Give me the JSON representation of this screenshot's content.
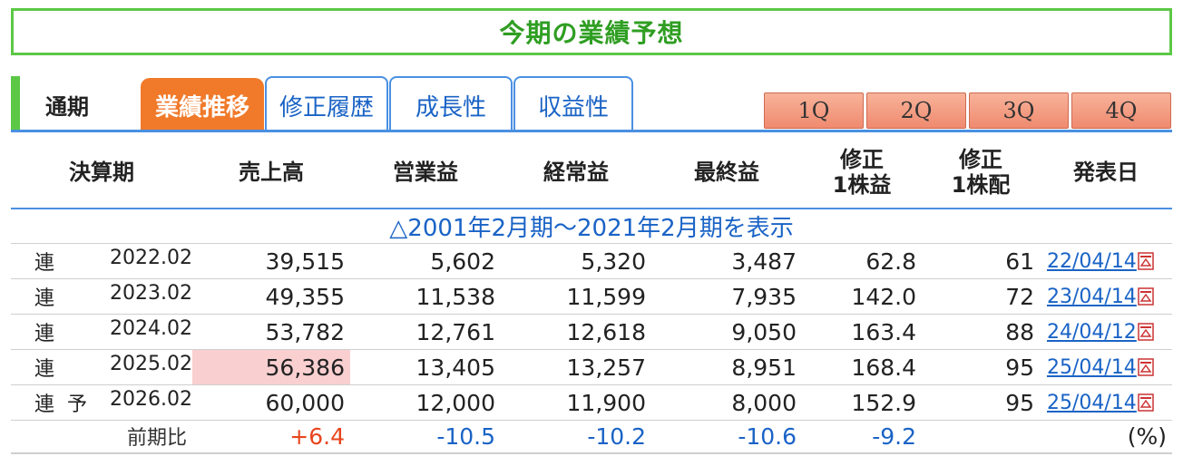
{
  "title": "今期の業績予想",
  "tabs": {
    "static_label": "通期",
    "items": [
      "業績推移",
      "修正履歴",
      "成長性",
      "収益性"
    ],
    "active": "業績推移",
    "quarters": [
      "1Q",
      "2Q",
      "3Q",
      "4Q"
    ]
  },
  "table": {
    "headers": {
      "period": "決算期",
      "sales": "売上高",
      "operating": "営業益",
      "ordinary": "経常益",
      "net": "最終益",
      "eps_line1": "修正",
      "eps_line2": "1株益",
      "div_line1": "修正",
      "div_line2": "1株配",
      "date": "発表日"
    },
    "history_link": "△2001年2月期～2021年2月期を表示",
    "rows": [
      {
        "kind": "連",
        "forecast": "",
        "period": "2022.02",
        "sales": "39,515",
        "operating": "5,602",
        "ordinary": "5,320",
        "net": "3,487",
        "eps": "62.8",
        "div": "61",
        "date": "22/04/14"
      },
      {
        "kind": "連",
        "forecast": "",
        "period": "2023.02",
        "sales": "49,355",
        "operating": "11,538",
        "ordinary": "11,599",
        "net": "7,935",
        "eps": "142.0",
        "div": "72",
        "date": "23/04/14"
      },
      {
        "kind": "連",
        "forecast": "",
        "period": "2024.02",
        "sales": "53,782",
        "operating": "12,761",
        "ordinary": "12,618",
        "net": "9,050",
        "eps": "163.4",
        "div": "88",
        "date": "24/04/12"
      },
      {
        "kind": "連",
        "forecast": "",
        "period": "2025.02",
        "sales": "56,386",
        "operating": "13,405",
        "ordinary": "13,257",
        "net": "8,951",
        "eps": "168.4",
        "div": "95",
        "date": "25/04/14"
      },
      {
        "kind": "連",
        "forecast": "予",
        "period": "2026.02",
        "sales": "60,000",
        "operating": "12,000",
        "ordinary": "11,900",
        "net": "8,000",
        "eps": "152.9",
        "div": "95",
        "date": "25/04/14"
      }
    ],
    "ratio": {
      "label": "前期比",
      "sales": "+6.4",
      "operating": "-10.5",
      "ordinary": "-10.2",
      "net": "-10.6",
      "eps": "-9.2",
      "unit": "(%)"
    }
  },
  "colors": {
    "accent_green": "#5cc846",
    "title_green": "#2f9e22",
    "tab_blue": "#4a90e2",
    "active_tab_orange": "#f07a2a",
    "highlight_pink": "#f9cfd0",
    "positive_red": "#e8451e",
    "negative_blue": "#1a63c6"
  },
  "icons": {
    "date_icon": "pdf-icon"
  }
}
